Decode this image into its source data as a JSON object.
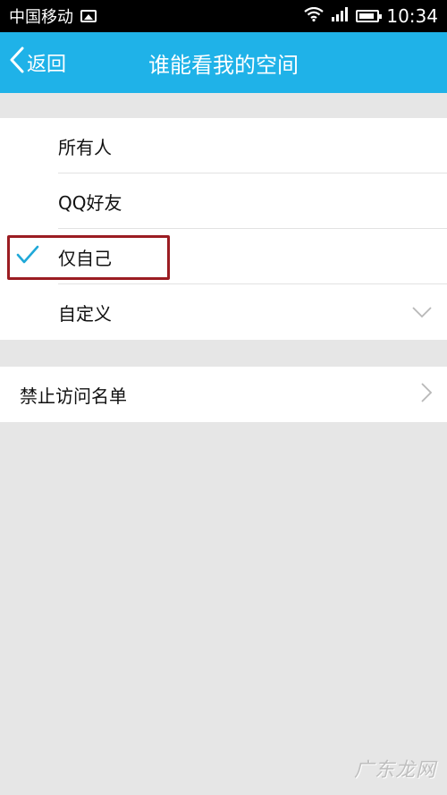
{
  "status_bar": {
    "carrier": "中国移动",
    "time": "10:34"
  },
  "nav": {
    "back_label": "返回",
    "title": "谁能看我的空间"
  },
  "options": [
    {
      "label": "所有人",
      "selected": false
    },
    {
      "label": "QQ好友",
      "selected": false
    },
    {
      "label": "仅自己",
      "selected": true
    },
    {
      "label": "自定义",
      "selected": false
    }
  ],
  "blacklist": {
    "label": "禁止访问名单"
  },
  "watermark": "广东龙网",
  "colors": {
    "accent": "#1fb2e8",
    "highlight_border": "#9b1c22"
  }
}
